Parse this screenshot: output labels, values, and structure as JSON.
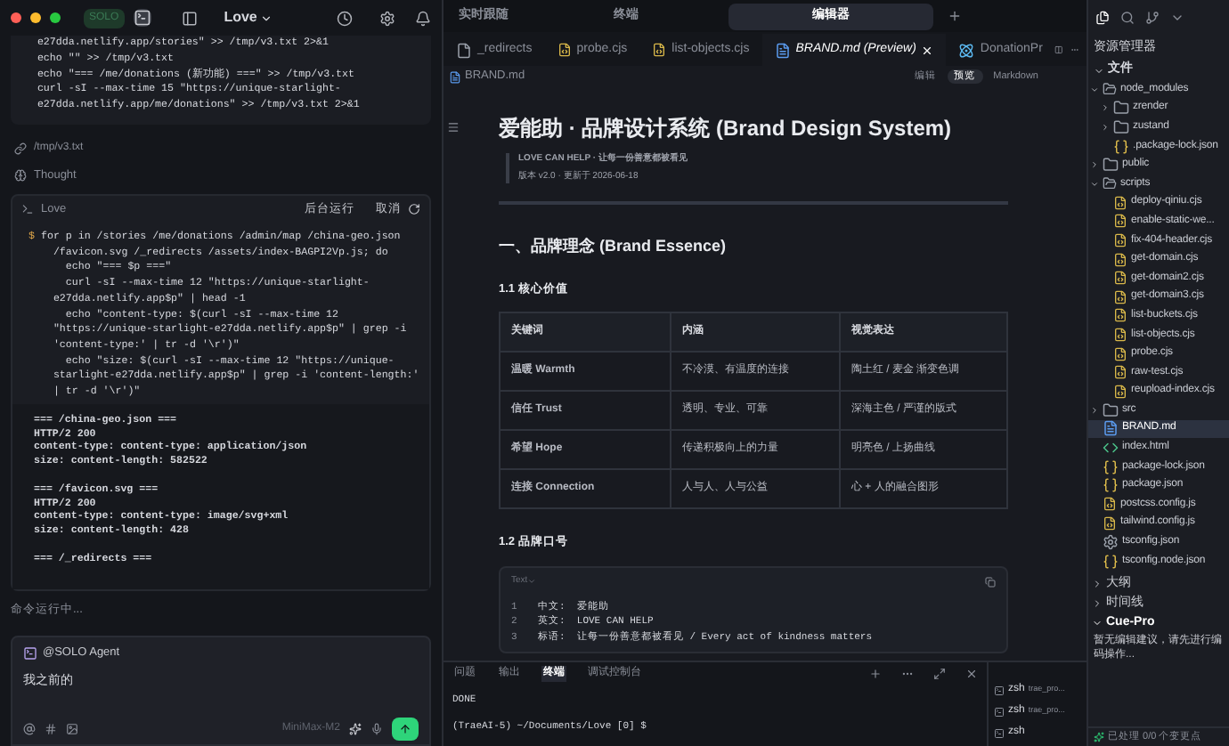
{
  "topbar": {
    "mode_label": "SOLO",
    "project": "Love"
  },
  "previous_command": {
    "lines": [
      "  e27dda.netlify.app/stories\" >> /tmp/v3.txt 2>&1",
      "  echo \"\" >> /tmp/v3.txt",
      "  echo \"=== /me/donations (新功能) ===\" >> /tmp/v3.txt",
      "  curl -sI --max-time 15 \"https://unique-starlight-",
      "  e27dda.netlify.app/me/donations\" >> /tmp/v3.txt 2>&1"
    ]
  },
  "file_ref": "/tmp/v3.txt",
  "thought": "Thought",
  "terminal_card": {
    "title": "Love",
    "background_button": "后台运行",
    "cancel_button": "取消",
    "prompt": "$",
    "command_lines": [
      "for p in /stories /me/donations /admin/map /china-geo.json",
      "  /favicon.svg /_redirects /assets/index-BAGPI2Vp.js; do",
      "    echo \"=== $p ===\"",
      "    curl -sI --max-time 12 \"https://unique-starlight-",
      "  e27dda.netlify.app$p\" | head -1",
      "    echo \"content-type: $(curl -sI --max-time 12",
      "  \"https://unique-starlight-e27dda.netlify.app$p\" | grep -i",
      "  'content-type:' | tr -d '\\r')\"",
      "    echo \"size: $(curl -sI --max-time 12 \"https://unique-",
      "  starlight-e27dda.netlify.app$p\" | grep -i 'content-length:'",
      "  | tr -d '\\r')\""
    ],
    "output_groups": [
      [
        "=== /china-geo.json ===",
        "HTTP/2 200",
        "content-type: content-type: application/json",
        "size: content-length: 582522"
      ],
      [
        "=== /favicon.svg ===",
        "HTTP/2 200",
        "content-type: content-type: image/svg+xml",
        "size: content-length: 428"
      ],
      [
        "=== /_redirects ==="
      ]
    ]
  },
  "running_status": "命令运行中...",
  "chat": {
    "agent": "@SOLO Agent",
    "value": "我之前的",
    "model": "MiniMax-M2"
  },
  "view_tabs": [
    {
      "label": "实时跟随",
      "selected": false
    },
    {
      "label": "终端",
      "selected": false
    },
    {
      "label": "编辑器",
      "selected": true
    }
  ],
  "file_tabs": [
    {
      "label": "_redirects",
      "kind": "file",
      "selected": false
    },
    {
      "label": "probe.cjs",
      "kind": "js",
      "selected": false
    },
    {
      "label": "list-objects.cjs",
      "kind": "js",
      "selected": false
    },
    {
      "label": "BRAND.md (Preview)",
      "kind": "md",
      "selected": true
    },
    {
      "label": "DonationPr",
      "kind": "react",
      "selected": false
    }
  ],
  "breadcrumb": "BRAND.md",
  "view_modes": [
    {
      "label": "编辑",
      "selected": false
    },
    {
      "label": "预览",
      "selected": true
    },
    {
      "label": "Markdown",
      "selected": false
    }
  ],
  "document": {
    "title": "爱能助 · 品牌设计系统 (Brand Design System)",
    "quote_lines": [
      "LOVE CAN HELP · 让每一份善意都被看见",
      "版本 v2.0 · 更新于 2026-06-18"
    ],
    "section": "一、品牌理念 (Brand Essence)",
    "subsection_1": "1.1 核心价值",
    "table": {
      "columns": [
        "关键词",
        "内涵",
        "视觉表达"
      ],
      "rows": [
        [
          "温暖 Warmth",
          "不冷漠、有温度的连接",
          "陶土红 / 麦金 渐变色调"
        ],
        [
          "信任 Trust",
          "透明、专业、可靠",
          "深海主色 / 严谨的版式"
        ],
        [
          "希望 Hope",
          "传递积极向上的力量",
          "明亮色 / 上扬曲线"
        ],
        [
          "连接 Connection",
          "人与人、人与公益",
          "心 + 人的融合图形"
        ]
      ]
    },
    "subsection_2": "1.2 品牌口号",
    "code_block": {
      "language": "Text",
      "lines": [
        {
          "number": "1",
          "text": "中文:  爱能助"
        },
        {
          "number": "2",
          "text": "英文:  LOVE CAN HELP"
        },
        {
          "number": "3",
          "text": "标语:  让每一份善意都被看见 / Every act of kindness matters"
        }
      ]
    }
  },
  "panel_tabs": [
    {
      "label": "问题",
      "selected": false
    },
    {
      "label": "输出",
      "selected": false
    },
    {
      "label": "终端",
      "selected": true
    },
    {
      "label": "调试控制台",
      "selected": false
    }
  ],
  "terminal": {
    "lines": [
      "DONE",
      "(TraeAI-5) ~/Documents/Love [0] $"
    ]
  },
  "terminal_list": [
    {
      "shell": "zsh",
      "name": "trae_pro..."
    },
    {
      "shell": "zsh",
      "name": "trae_pro..."
    },
    {
      "shell": "zsh"
    }
  ],
  "explorer": {
    "title": "资源管理器",
    "section": "文件",
    "tree": [
      {
        "label": "node_modules",
        "kind": "folder",
        "expanded": true,
        "selected": false,
        "children": [
          {
            "label": "zrender",
            "kind": "folder",
            "expanded": false,
            "selected": false
          },
          {
            "label": "zustand",
            "kind": "folder",
            "expanded": false,
            "selected": false
          },
          {
            "label": ".package-lock.json",
            "kind": "json",
            "selected": false
          }
        ]
      },
      {
        "label": "public",
        "kind": "folder",
        "expanded": false,
        "selected": false
      },
      {
        "label": "scripts",
        "kind": "folder",
        "expanded": true,
        "selected": false,
        "children": [
          {
            "label": "deploy-qiniu.cjs",
            "kind": "js",
            "selected": false
          },
          {
            "label": "enable-static-we...",
            "kind": "js",
            "selected": false
          },
          {
            "label": "fix-404-header.cjs",
            "kind": "js",
            "selected": false
          },
          {
            "label": "get-domain.cjs",
            "kind": "js",
            "selected": false
          },
          {
            "label": "get-domain2.cjs",
            "kind": "js",
            "selected": false
          },
          {
            "label": "get-domain3.cjs",
            "kind": "js",
            "selected": false
          },
          {
            "label": "list-buckets.cjs",
            "kind": "js",
            "selected": false
          },
          {
            "label": "list-objects.cjs",
            "kind": "js",
            "selected": false
          },
          {
            "label": "probe.cjs",
            "kind": "js",
            "selected": false
          },
          {
            "label": "raw-test.cjs",
            "kind": "js",
            "selected": false
          },
          {
            "label": "reupload-index.cjs",
            "kind": "js",
            "selected": false
          }
        ]
      },
      {
        "label": "src",
        "kind": "folder",
        "expanded": false,
        "selected": false
      },
      {
        "label": "BRAND.md",
        "kind": "md",
        "selected": true
      },
      {
        "label": "index.html",
        "kind": "html",
        "selected": false
      },
      {
        "label": "package-lock.json",
        "kind": "json",
        "selected": false
      },
      {
        "label": "package.json",
        "kind": "json",
        "selected": false
      },
      {
        "label": "postcss.config.js",
        "kind": "js",
        "selected": false
      },
      {
        "label": "tailwind.config.js",
        "kind": "js",
        "selected": false
      },
      {
        "label": "tsconfig.json",
        "kind": "config",
        "selected": false
      },
      {
        "label": "tsconfig.node.json",
        "kind": "json",
        "selected": false
      }
    ]
  },
  "outline_sections": [
    {
      "label": "大纲",
      "expanded": false
    },
    {
      "label": "时间线",
      "expanded": false
    },
    {
      "label": "Cue-Pro",
      "expanded": true
    }
  ],
  "cue_message": "暂无编辑建议，请先进行编码操作...",
  "status": "已处理 0/0 个变更点"
}
